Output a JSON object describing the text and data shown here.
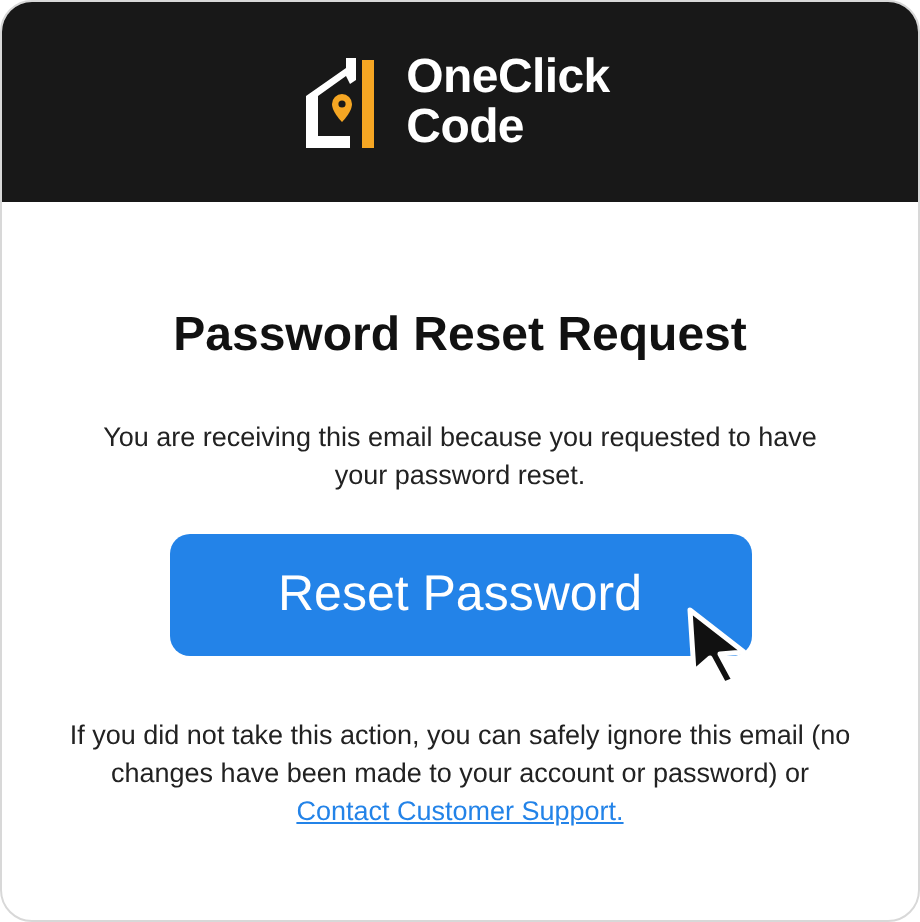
{
  "header": {
    "brand_lines": [
      "OneClick",
      "Code"
    ]
  },
  "title": "Password Reset Request",
  "intro": "You are receiving this email because you requested to have your password reset.",
  "button": {
    "label": "Reset Password"
  },
  "footer": {
    "text": "If you did not take this action, you can safely ignore this email (no changes have been made to your account or password) or",
    "link": "Contact Customer Support."
  }
}
